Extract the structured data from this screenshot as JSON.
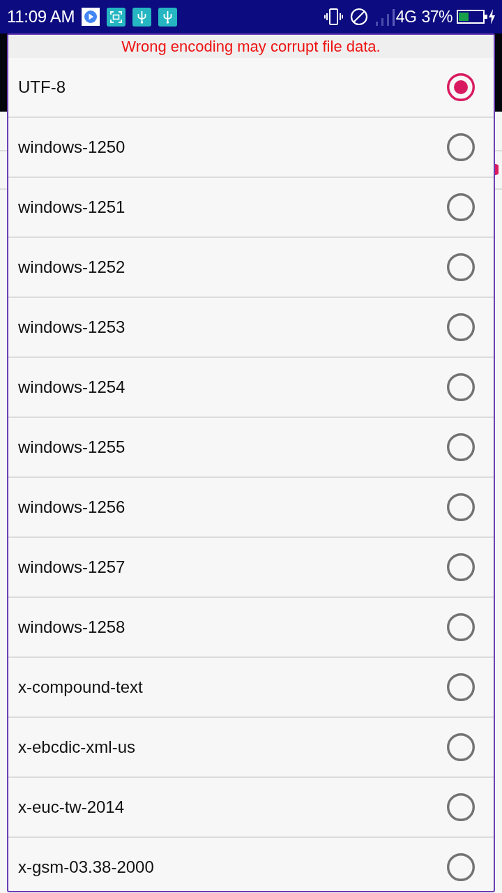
{
  "status_bar": {
    "time": "11:09 AM",
    "network": "4G",
    "battery": "37%"
  },
  "dialog": {
    "warning": "Wrong encoding may corrupt file data.",
    "options": [
      {
        "label": "UTF-8",
        "selected": true
      },
      {
        "label": "windows-1250",
        "selected": false
      },
      {
        "label": "windows-1251",
        "selected": false
      },
      {
        "label": "windows-1252",
        "selected": false
      },
      {
        "label": "windows-1253",
        "selected": false
      },
      {
        "label": "windows-1254",
        "selected": false
      },
      {
        "label": "windows-1255",
        "selected": false
      },
      {
        "label": "windows-1256",
        "selected": false
      },
      {
        "label": "windows-1257",
        "selected": false
      },
      {
        "label": "windows-1258",
        "selected": false
      },
      {
        "label": "x-compound-text",
        "selected": false
      },
      {
        "label": "x-ebcdic-xml-us",
        "selected": false
      },
      {
        "label": "x-euc-tw-2014",
        "selected": false
      },
      {
        "label": "x-gsm-03.38-2000",
        "selected": false
      }
    ]
  }
}
